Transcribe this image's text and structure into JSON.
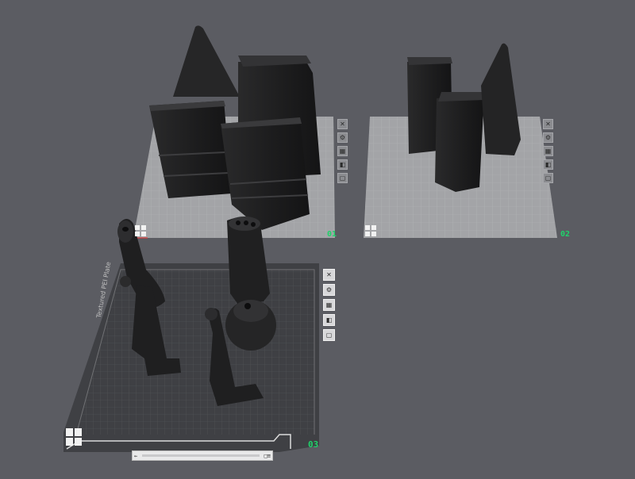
{
  "plates": [
    {
      "id": "plate-01",
      "label": "01"
    },
    {
      "id": "plate-02",
      "label": "02"
    },
    {
      "id": "plate-03",
      "label": "03"
    }
  ],
  "plate_tools": [
    "close",
    "settings",
    "arrange",
    "orient",
    "lock"
  ],
  "plate3": {
    "bed_text": "Textured PEI Plate",
    "bar_left": "←",
    "bar_right": "□≡"
  },
  "colors": {
    "background": "#5b5c62",
    "plate_light": "#9fa0a3",
    "plate_dark": "#3c3d41",
    "model": "#1f1f20",
    "label_green": "#1fd36a"
  }
}
